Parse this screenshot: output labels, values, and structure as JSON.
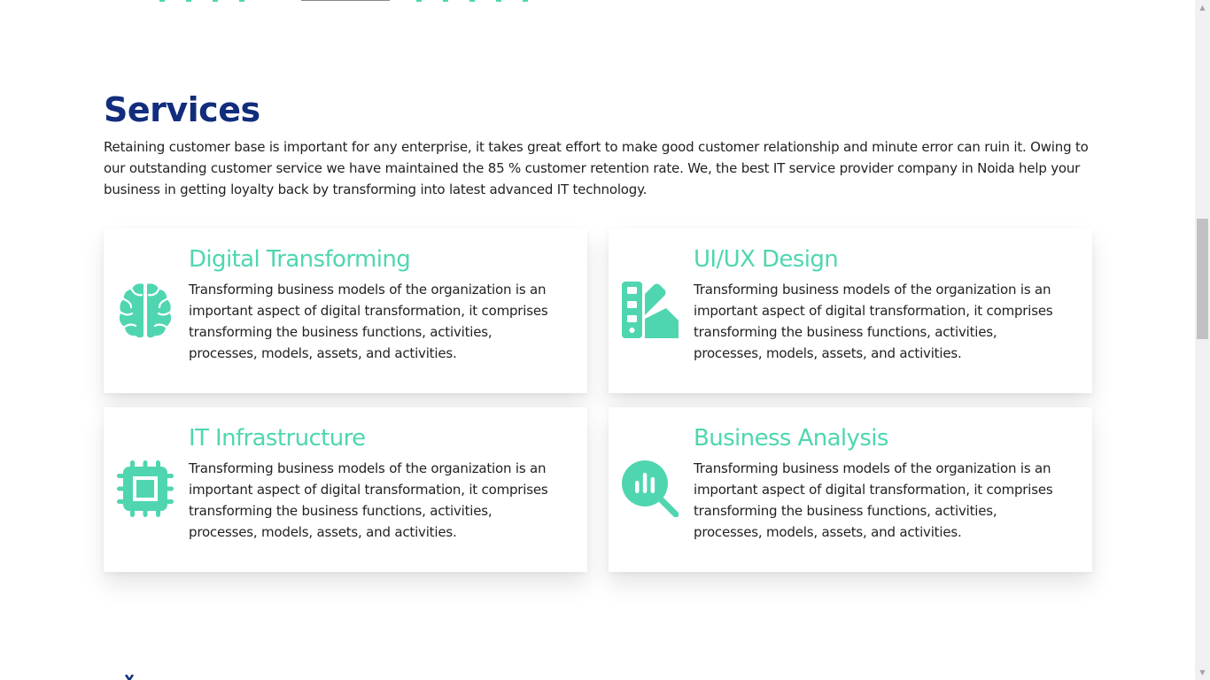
{
  "services": {
    "title": "Services",
    "description": "Retaining customer base is important for any enterprise, it takes great effort to make good customer relationship and minute error can ruin it. Owing to our outstanding customer service we have maintained the 85 % customer retention rate. We, the best IT service provider company in Noida help your business in getting loyalty back by transforming into latest advanced IT technology."
  },
  "cards": [
    {
      "title": "Digital Transforming",
      "icon": "brain-icon",
      "text": "Transforming business models of the organization is an important aspect of digital transformation, it comprises transforming the business functions, activities, processes, models, assets, and activities."
    },
    {
      "title": "UI/UX Design",
      "icon": "swatchbook-icon",
      "text": "Transforming business models of the organization is an important aspect of digital transformation, it comprises transforming the business functions, activities, processes, models, assets, and activities."
    },
    {
      "title": "IT Infrastructure",
      "icon": "microchip-icon",
      "text": "Transforming business models of the organization is an important aspect of digital transformation, it comprises transforming the business functions, activities, processes, models, assets, and activities."
    },
    {
      "title": "Business Analysis",
      "icon": "magnifier-chart-icon",
      "text": "Transforming business models of the organization is an important aspect of digital transformation, it comprises transforming the business functions, activities, processes, models, assets, and activities."
    }
  ],
  "colors": {
    "title_navy": "#112d7c",
    "accent_teal": "#4fd6b0",
    "body_text": "#222222"
  }
}
